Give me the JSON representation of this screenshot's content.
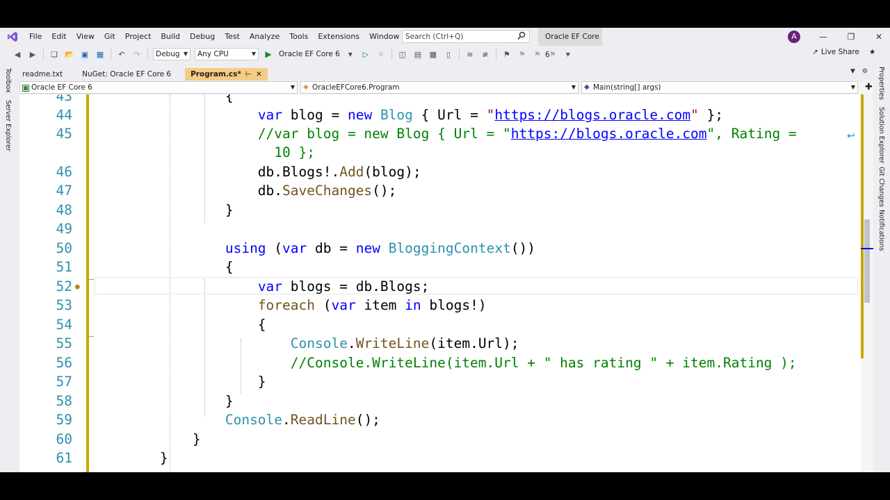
{
  "menu": {
    "items": [
      "File",
      "Edit",
      "View",
      "Git",
      "Project",
      "Build",
      "Debug",
      "Test",
      "Analyze",
      "Tools",
      "Extensions",
      "Window",
      "Help"
    ],
    "search_placeholder": "Search (Ctrl+Q)",
    "solution_title": "Oracle EF Core 6",
    "avatar_initial": "A"
  },
  "toolbar": {
    "config": "Debug",
    "platform": "Any CPU",
    "start_project": "Oracle EF Core 6",
    "live_share": "Live Share"
  },
  "left_dock": {
    "toolbox": "Toolbox",
    "server_explorer": "Server Explorer"
  },
  "right_dock": {
    "properties": "Properties",
    "solution_explorer": "Solution Explorer",
    "git_changes": "Git Changes",
    "notifications": "Notifications"
  },
  "tabs": [
    "readme.txt",
    "NuGet: Oracle EF Core 6",
    "Program.cs*"
  ],
  "nav": {
    "project": "Oracle EF Core 6",
    "class": "OracleEFCore6.Program",
    "member": "Main(string[] args)"
  },
  "code": {
    "l43": "43",
    "l44": "44",
    "l45": "45",
    "l46": "46",
    "l47": "47",
    "l48": "48",
    "l49": "49",
    "l50": "50",
    "l51": "51",
    "l52": "52",
    "l53": "53",
    "l54": "54",
    "l55": "55",
    "l56": "56",
    "l57": "57",
    "l58": "58",
    "l59": "59",
    "l60": "60",
    "l61": "61",
    "url": "https://blogs.oracle.com",
    "comment45a": "//var blog = new Blog { Url = \"",
    "comment45b": "\", Rating =",
    "comment45c": "10 };",
    "comment56": "//Console.WriteLine(item.Url + \" has rating \" + item.Rating );"
  }
}
